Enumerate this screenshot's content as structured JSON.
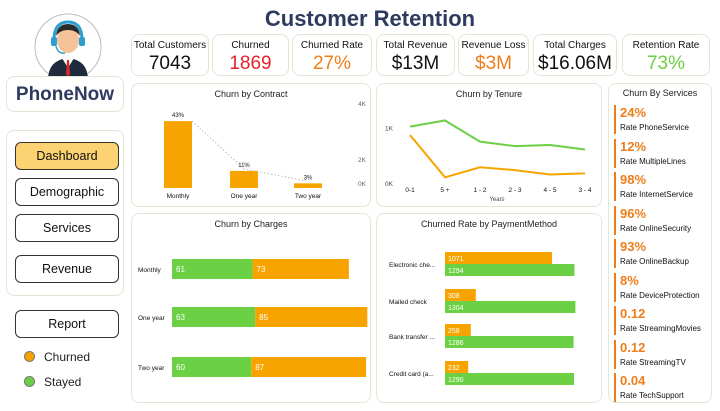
{
  "title": "Customer Retention",
  "brand": "PhoneNow",
  "colors": {
    "churned": "#f7a400",
    "stayed": "#6bd043",
    "accent": "#ee7d1a",
    "title": "#2e3b5e"
  },
  "kpis": [
    {
      "label": "Total Customers",
      "value": "7043",
      "color": "#111111"
    },
    {
      "label": "Churned",
      "value": "1869",
      "color": "#e8222c"
    },
    {
      "label": "Churned Rate",
      "value": "27%",
      "color": "#ee7d1a"
    },
    {
      "label": "Total Revenue",
      "value": "$13M",
      "color": "#111111"
    },
    {
      "label": "Revenue Loss",
      "value": "$3M",
      "color": "#ee7d1a"
    },
    {
      "label": "Total Charges",
      "value": "$16.06M",
      "color": "#111111"
    },
    {
      "label": "Retention Rate",
      "value": "73%",
      "color": "#6bd043"
    }
  ],
  "nav": {
    "dashboard": "Dashboard",
    "demographic": "Demographic",
    "services": "Services",
    "revenue": "Revenue",
    "report": "Report"
  },
  "legend": {
    "churned": "Churned",
    "stayed": "Stayed"
  },
  "chart_data": [
    {
      "type": "bar",
      "title": "Churn by Contract",
      "categories": [
        "Monthly",
        "One year",
        "Two year"
      ],
      "values": [
        43,
        11,
        3
      ],
      "data_labels": [
        "43%",
        "11%",
        "3%"
      ],
      "secondary_axis_ticks": [
        "4K",
        "2K",
        "0K"
      ]
    },
    {
      "type": "line",
      "title": "Churn by Tenure",
      "xlabel": "Years",
      "categories": [
        "0-1",
        "5 +",
        "1 - 2",
        "2 - 3",
        "4 - 5",
        "3 - 4"
      ],
      "y_ticks": [
        "1K",
        "0K"
      ],
      "ylim": [
        0,
        1400
      ],
      "series": [
        {
          "values": [
            1030,
            1140,
            760,
            680,
            700,
            620
          ]
        },
        {
          "values": [
            880,
            120,
            300,
            250,
            170,
            190
          ]
        }
      ]
    },
    {
      "type": "bar",
      "title": "Churn by Charges",
      "orientation": "horizontal-stacked",
      "categories": [
        "Monthly",
        "One year",
        "Two year"
      ],
      "series": [
        {
          "values": [
            61,
            63,
            60
          ]
        },
        {
          "values": [
            73,
            85,
            87
          ]
        }
      ]
    },
    {
      "type": "bar",
      "title": "Churned Rate by PaymentMethod",
      "orientation": "horizontal",
      "categories": [
        "Electronic che...",
        "Mailed check",
        "Bank transfer ...",
        "Credit card (a..."
      ],
      "series": [
        {
          "values": [
            1071,
            308,
            258,
            232
          ]
        },
        {
          "values": [
            1294,
            1304,
            1286,
            1290
          ]
        }
      ]
    }
  ],
  "services_panel": {
    "title": "Churn By Services",
    "items": [
      {
        "pct": "24%",
        "label": "Rate PhoneService"
      },
      {
        "pct": "12%",
        "label": "Rate MultipleLines"
      },
      {
        "pct": "98%",
        "label": "Rate InternetService"
      },
      {
        "pct": "96%",
        "label": "Rate OnlineSecurity"
      },
      {
        "pct": "93%",
        "label": "Rate OnlineBackup"
      },
      {
        "pct": "8%",
        "label": "Rate DeviceProtection"
      },
      {
        "pct": "0.12",
        "label": "Rate StreamingMovies"
      },
      {
        "pct": "0.12",
        "label": "Rate StreamingTV"
      },
      {
        "pct": "0.04",
        "label": "Rate TechSupport"
      }
    ]
  }
}
